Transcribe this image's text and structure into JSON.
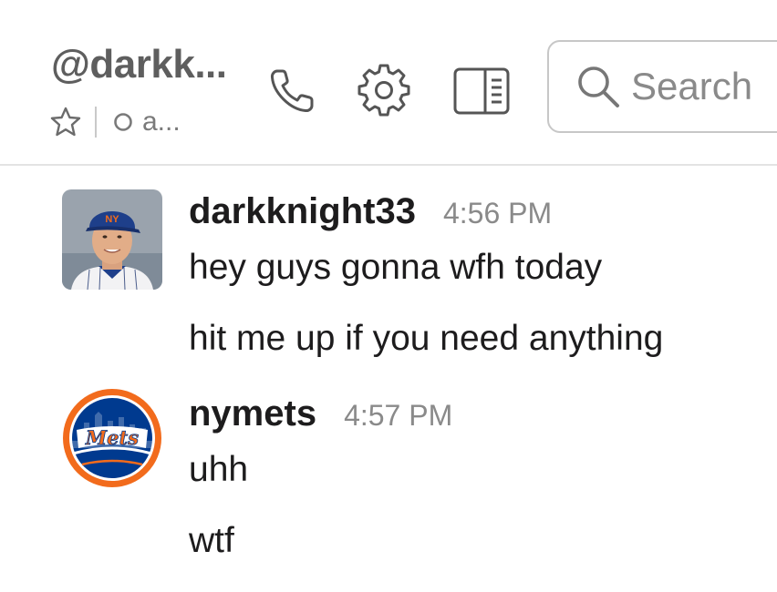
{
  "header": {
    "channel_title": "@darkk...",
    "status_text": "a...",
    "icons": [
      "star-icon",
      "presence-icon",
      "call-icon",
      "gear-icon",
      "details-icon",
      "search-icon"
    ],
    "search_placeholder": "Search"
  },
  "messages": [
    {
      "sender": "darkknight33",
      "time": "4:56 PM",
      "avatar": "baseball-player-photo",
      "lines": [
        "hey guys gonna wfh today",
        "hit me up if you need anything"
      ]
    },
    {
      "sender": "nymets",
      "time": "4:57 PM",
      "avatar": "mets-logo",
      "lines": [
        "uhh",
        "wtf"
      ]
    }
  ],
  "colors": {
    "mets_blue": "#003a8f",
    "mets_orange": "#f26b1c",
    "title_gray": "#5e5e5e",
    "timestamp_gray": "#8a8a8a",
    "divider": "#e3e3e3"
  }
}
